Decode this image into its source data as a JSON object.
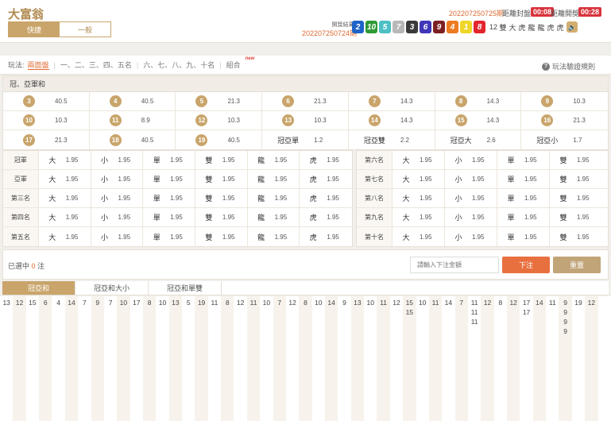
{
  "app": {
    "title": "大富翁"
  },
  "mode_tabs": [
    {
      "label": "快捷",
      "active": true
    },
    {
      "label": "一般",
      "active": false
    }
  ],
  "header": {
    "current_period": "202207250725期",
    "countdown1_label": "距離封盤",
    "countdown1_value": "00:08",
    "countdown2_label": "距離開獎",
    "countdown2_value": "00:28",
    "result_label": "開獎結果",
    "result_period": "202207250724期"
  },
  "results": {
    "balls": [
      {
        "n": "2",
        "color": "#1e64c8"
      },
      {
        "n": "10",
        "color": "#2e9b35"
      },
      {
        "n": "5",
        "color": "#4cc0c4"
      },
      {
        "n": "7",
        "color": "#b8b8b8"
      },
      {
        "n": "3",
        "color": "#3a3a3a"
      },
      {
        "n": "6",
        "color": "#3f37b8"
      },
      {
        "n": "9",
        "color": "#7c1f23"
      },
      {
        "n": "4",
        "color": "#ee7b20"
      },
      {
        "n": "1",
        "color": "#f0d629"
      },
      {
        "n": "8",
        "color": "#e3252d"
      }
    ],
    "extras": [
      "12",
      "雙",
      "大",
      "虎",
      "龍",
      "龍",
      "虎",
      "虎"
    ]
  },
  "play": {
    "label": "玩法:",
    "items": [
      {
        "label": "兩面盤",
        "active": true
      },
      {
        "label": "一、二、三、四、五名",
        "active": false
      },
      {
        "label": "六、七、八、九、十名",
        "active": false
      },
      {
        "label": "組合",
        "active": false
      }
    ],
    "new_badge": "new",
    "rules_label": "玩法驗證規則"
  },
  "section_title": "冠、亞軍和",
  "sum_table": [
    [
      {
        "k": "3",
        "o": "40.5"
      },
      {
        "k": "4",
        "o": "40.5"
      },
      {
        "k": "5",
        "o": "21.3"
      },
      {
        "k": "6",
        "o": "21.3"
      },
      {
        "k": "7",
        "o": "14.3"
      },
      {
        "k": "8",
        "o": "14.3"
      },
      {
        "k": "9",
        "o": "10.3"
      }
    ],
    [
      {
        "k": "10",
        "o": "10.3"
      },
      {
        "k": "11",
        "o": "8.9"
      },
      {
        "k": "12",
        "o": "10.3"
      },
      {
        "k": "13",
        "o": "10.3"
      },
      {
        "k": "14",
        "o": "14.3"
      },
      {
        "k": "15",
        "o": "14.3"
      },
      {
        "k": "16",
        "o": "21.3"
      }
    ],
    [
      {
        "k": "17",
        "o": "21.3"
      },
      {
        "k": "18",
        "o": "40.5"
      },
      {
        "k": "19",
        "o": "40.5"
      },
      {
        "k": "冠亞單",
        "o": "1.2",
        "text": true
      },
      {
        "k": "冠亞雙",
        "o": "2.2",
        "text": true
      },
      {
        "k": "冠亞大",
        "o": "2.6",
        "text": true
      },
      {
        "k": "冠亞小",
        "o": "1.7",
        "text": true
      }
    ]
  ],
  "left_table": {
    "rows": [
      {
        "label": "冠軍",
        "cells": [
          {
            "k": "大",
            "o": "1.95"
          },
          {
            "k": "小",
            "o": "1.95"
          },
          {
            "k": "單",
            "o": "1.95"
          },
          {
            "k": "雙",
            "o": "1.95"
          },
          {
            "k": "龍",
            "o": "1.95"
          },
          {
            "k": "虎",
            "o": "1.95"
          }
        ]
      },
      {
        "label": "亞軍",
        "cells": [
          {
            "k": "大",
            "o": "1.95"
          },
          {
            "k": "小",
            "o": "1.95"
          },
          {
            "k": "單",
            "o": "1.95"
          },
          {
            "k": "雙",
            "o": "1.95"
          },
          {
            "k": "龍",
            "o": "1.95"
          },
          {
            "k": "虎",
            "o": "1.95"
          }
        ]
      },
      {
        "label": "第三名",
        "cells": [
          {
            "k": "大",
            "o": "1.95"
          },
          {
            "k": "小",
            "o": "1.95"
          },
          {
            "k": "單",
            "o": "1.95"
          },
          {
            "k": "雙",
            "o": "1.95"
          },
          {
            "k": "龍",
            "o": "1.95"
          },
          {
            "k": "虎",
            "o": "1.95"
          }
        ]
      },
      {
        "label": "第四名",
        "cells": [
          {
            "k": "大",
            "o": "1.95"
          },
          {
            "k": "小",
            "o": "1.95"
          },
          {
            "k": "單",
            "o": "1.95"
          },
          {
            "k": "雙",
            "o": "1.95"
          },
          {
            "k": "龍",
            "o": "1.95"
          },
          {
            "k": "虎",
            "o": "1.95"
          }
        ]
      },
      {
        "label": "第五名",
        "cells": [
          {
            "k": "大",
            "o": "1.95"
          },
          {
            "k": "小",
            "o": "1.95"
          },
          {
            "k": "單",
            "o": "1.95"
          },
          {
            "k": "雙",
            "o": "1.95"
          },
          {
            "k": "龍",
            "o": "1.95"
          },
          {
            "k": "虎",
            "o": "1.95"
          }
        ]
      }
    ]
  },
  "right_table": {
    "rows": [
      {
        "label": "第六名",
        "cells": [
          {
            "k": "大",
            "o": "1.95"
          },
          {
            "k": "小",
            "o": "1.95"
          },
          {
            "k": "單",
            "o": "1.95"
          },
          {
            "k": "雙",
            "o": "1.95"
          }
        ]
      },
      {
        "label": "第七名",
        "cells": [
          {
            "k": "大",
            "o": "1.95"
          },
          {
            "k": "小",
            "o": "1.95"
          },
          {
            "k": "單",
            "o": "1.95"
          },
          {
            "k": "雙",
            "o": "1.95"
          }
        ]
      },
      {
        "label": "第八名",
        "cells": [
          {
            "k": "大",
            "o": "1.95"
          },
          {
            "k": "小",
            "o": "1.95"
          },
          {
            "k": "單",
            "o": "1.95"
          },
          {
            "k": "雙",
            "o": "1.95"
          }
        ]
      },
      {
        "label": "第九名",
        "cells": [
          {
            "k": "大",
            "o": "1.95"
          },
          {
            "k": "小",
            "o": "1.95"
          },
          {
            "k": "單",
            "o": "1.95"
          },
          {
            "k": "雙",
            "o": "1.95"
          }
        ]
      },
      {
        "label": "第十名",
        "cells": [
          {
            "k": "大",
            "o": "1.95"
          },
          {
            "k": "小",
            "o": "1.95"
          },
          {
            "k": "單",
            "o": "1.95"
          },
          {
            "k": "雙",
            "o": "1.95"
          }
        ]
      }
    ]
  },
  "bet": {
    "selected_prefix": "已選中 ",
    "selected_count": "0",
    "selected_suffix": " 注",
    "amount_placeholder": "請輸入下注金額",
    "submit_label": "下注",
    "reset_label": "重置"
  },
  "road_tabs": [
    {
      "label": "冠亞和",
      "active": true
    },
    {
      "label": "冠亞和大小",
      "active": false
    },
    {
      "label": "冠亞和單雙",
      "active": false
    }
  ],
  "road": [
    [
      "13"
    ],
    [
      "12"
    ],
    [
      "15"
    ],
    [
      "6"
    ],
    [
      "4"
    ],
    [
      "14"
    ],
    [
      "7"
    ],
    [
      "9"
    ],
    [
      "7"
    ],
    [
      "10"
    ],
    [
      "17"
    ],
    [
      "8"
    ],
    [
      "10"
    ],
    [
      "13"
    ],
    [
      "5"
    ],
    [
      "19"
    ],
    [
      "11"
    ],
    [
      "8"
    ],
    [
      "12"
    ],
    [
      "11"
    ],
    [
      "10"
    ],
    [
      "7"
    ],
    [
      "12"
    ],
    [
      "8"
    ],
    [
      "10"
    ],
    [
      "14"
    ],
    [
      "9"
    ],
    [
      "13"
    ],
    [
      "10"
    ],
    [
      "11"
    ],
    [
      "12"
    ],
    [
      "15",
      "15"
    ],
    [
      "10"
    ],
    [
      "11"
    ],
    [
      "14"
    ],
    [
      "7"
    ],
    [
      "11",
      "11",
      "11"
    ],
    [
      "12"
    ],
    [
      "8"
    ],
    [
      "12"
    ],
    [
      "17",
      "17"
    ],
    [
      "14"
    ],
    [
      "11"
    ],
    [
      "9",
      "9",
      "9",
      "9"
    ],
    [
      "19"
    ],
    [
      "12"
    ]
  ]
}
